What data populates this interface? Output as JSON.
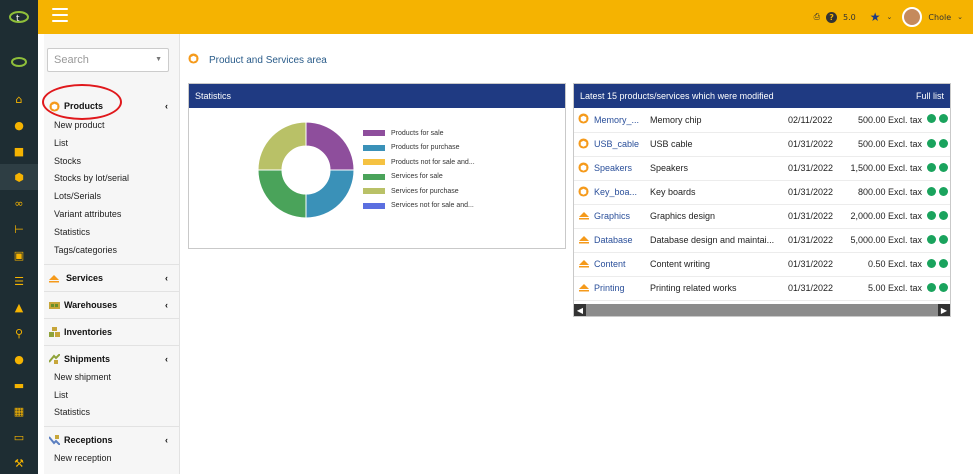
{
  "topbar": {
    "version": "5.0",
    "user": "Chole"
  },
  "search": {
    "placeholder": "Search"
  },
  "menu": {
    "products": {
      "label": "Products",
      "items": [
        "New product",
        "List",
        "Stocks",
        "Stocks by lot/serial",
        "Lots/Serials",
        "Variant attributes",
        "Statistics",
        "Tags/categories"
      ]
    },
    "services": {
      "label": "Services"
    },
    "warehouses": {
      "label": "Warehouses"
    },
    "inventories": {
      "label": "Inventories"
    },
    "shipments": {
      "label": "Shipments",
      "items": [
        "New shipment",
        "List",
        "Statistics"
      ]
    },
    "receptions": {
      "label": "Receptions",
      "items": [
        "New reception"
      ]
    }
  },
  "breadcrumb": "Product and Services area",
  "statistics": {
    "title": "Statistics",
    "legend": [
      {
        "label": "Products for sale",
        "color": "#8e4e9c"
      },
      {
        "label": "Products for purchase",
        "color": "#3a91b8"
      },
      {
        "label": "Products not for sale and...",
        "color": "#f5c242"
      },
      {
        "label": "Services for sale",
        "color": "#4aa35a"
      },
      {
        "label": "Services for purchase",
        "color": "#b9c167"
      },
      {
        "label": "Services not for sale and...",
        "color": "#5b6fe0"
      }
    ]
  },
  "chart_data": {
    "type": "pie",
    "donut": true,
    "categories": [
      "Products for sale",
      "Products for purchase",
      "Products not for sale and...",
      "Services for sale",
      "Services for purchase",
      "Services not for sale and..."
    ],
    "values": [
      25,
      25,
      0,
      25,
      25,
      0
    ],
    "colors": [
      "#8e4e9c",
      "#3a91b8",
      "#f5c242",
      "#4aa35a",
      "#b9c167",
      "#5b6fe0"
    ]
  },
  "latest": {
    "title": "Latest 15 products/services which were modified",
    "full_list": "Full list",
    "rows": [
      {
        "icon": "box-icon",
        "ref": "Memory_...",
        "label": "Memory chip",
        "date": "02/11/2022",
        "price": "500.00 Excl. tax"
      },
      {
        "icon": "box-icon",
        "ref": "USB_cable",
        "label": "USB cable",
        "date": "01/31/2022",
        "price": "500.00 Excl. tax"
      },
      {
        "icon": "box-icon",
        "ref": "Speakers",
        "label": "Speakers",
        "date": "01/31/2022",
        "price": "1,500.00 Excl. tax"
      },
      {
        "icon": "box-icon",
        "ref": "Key_boa...",
        "label": "Key boards",
        "date": "01/31/2022",
        "price": "800.00 Excl. tax"
      },
      {
        "icon": "service-icon",
        "ref": "Graphics",
        "label": "Graphics design",
        "date": "01/31/2022",
        "price": "2,000.00 Excl. tax"
      },
      {
        "icon": "service-icon",
        "ref": "Database",
        "label": "Database design and maintai...",
        "date": "01/31/2022",
        "price": "5,000.00 Excl. tax"
      },
      {
        "icon": "service-icon",
        "ref": "Content",
        "label": "Content writing",
        "date": "01/31/2022",
        "price": "0.50 Excl. tax"
      },
      {
        "icon": "service-icon",
        "ref": "Printing",
        "label": "Printing related works",
        "date": "01/31/2022",
        "price": "5.00 Excl. tax"
      }
    ]
  }
}
